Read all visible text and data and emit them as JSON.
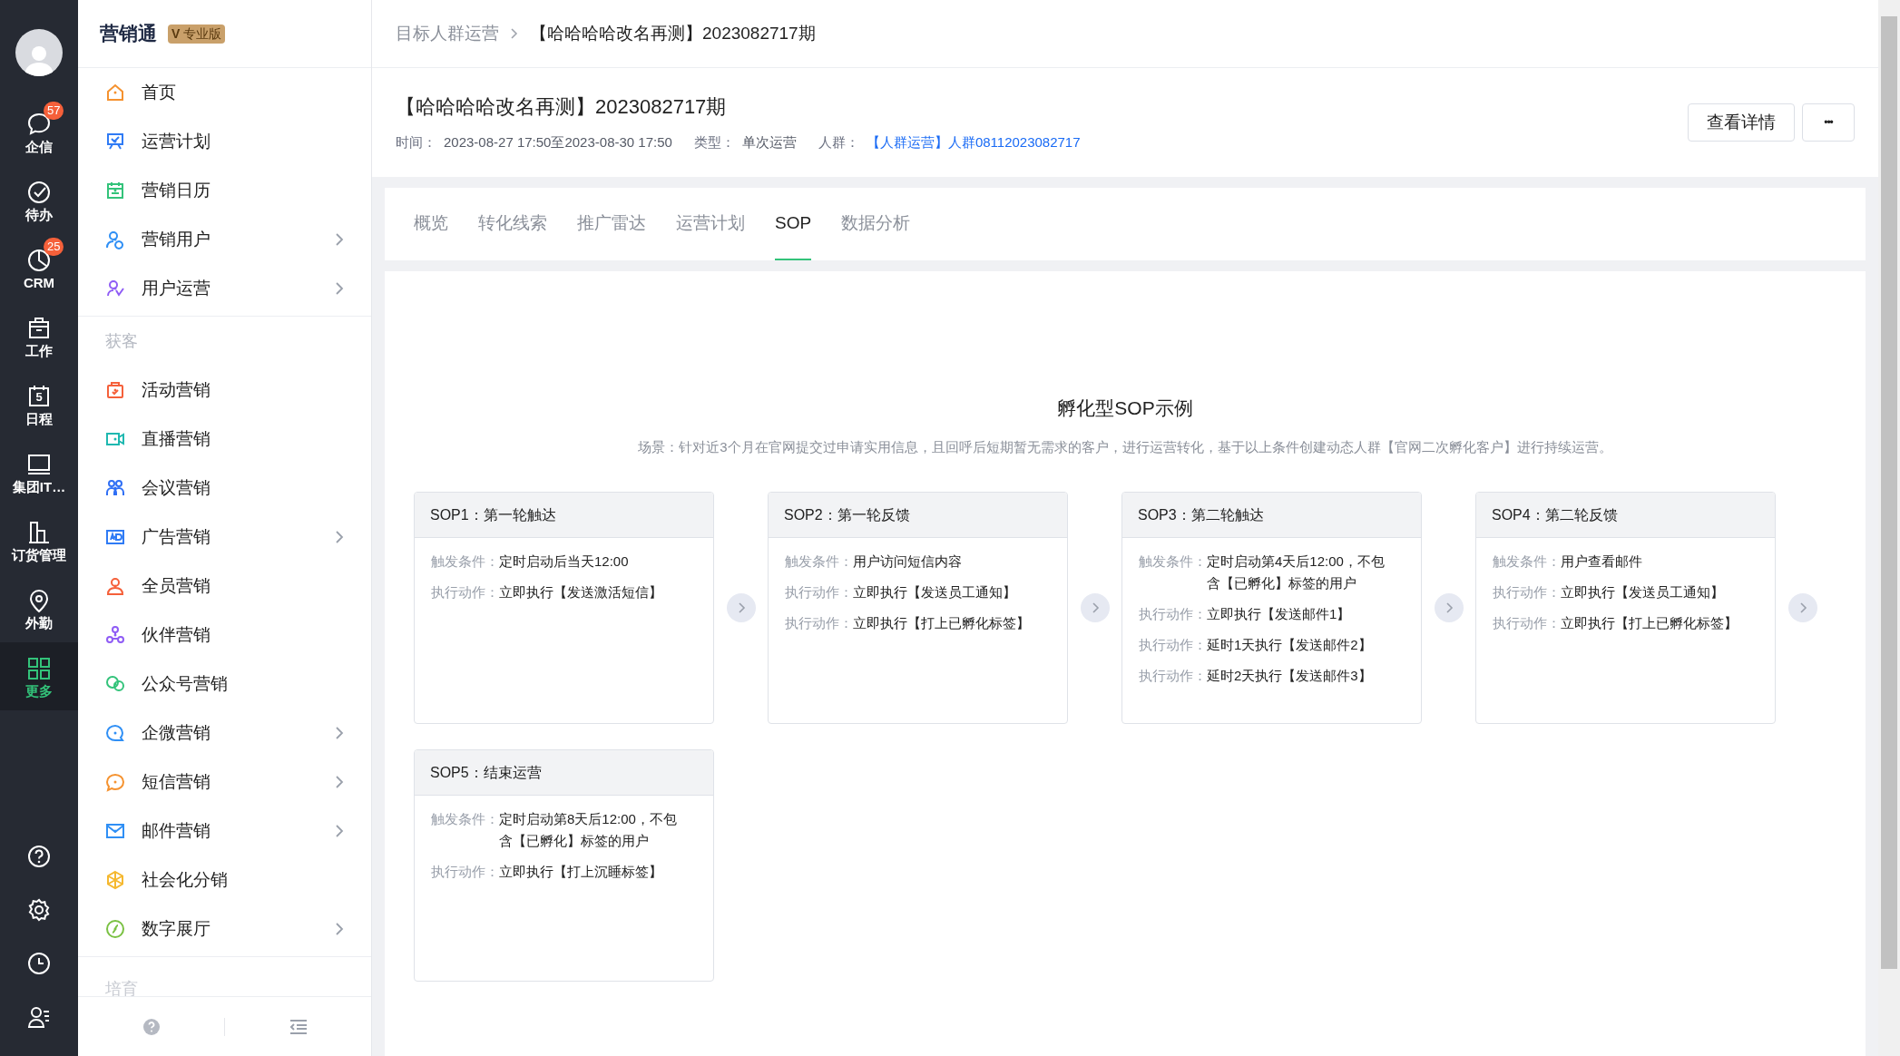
{
  "rail": {
    "items": [
      {
        "label": "企信",
        "badge": "57",
        "selected": false
      },
      {
        "label": "待办",
        "selected": false
      },
      {
        "label": "CRM",
        "badge": "25",
        "selected": false
      },
      {
        "label": "工作",
        "selected": false
      },
      {
        "label": "日程",
        "icon_text": "5",
        "selected": false
      },
      {
        "label": "集团IT…",
        "selected": false
      },
      {
        "label": "订货管理",
        "selected": false
      },
      {
        "label": "外勤",
        "selected": false
      },
      {
        "label": "更多",
        "selected": true
      }
    ]
  },
  "sidebar": {
    "app_name": "营销通",
    "edition": "专业版",
    "edition_mark": "V",
    "items": [
      {
        "label": "首页",
        "color": "#f5922f",
        "expandable": false
      },
      {
        "label": "运营计划",
        "color": "#2f7bf5",
        "expandable": false
      },
      {
        "label": "营销日历",
        "color": "#33c37a",
        "expandable": false
      },
      {
        "label": "营销用户",
        "color": "#2f8ff5",
        "expandable": true
      },
      {
        "label": "用户运营",
        "color": "#8f5cf5",
        "expandable": true
      }
    ],
    "section": "获客",
    "section_items": [
      {
        "label": "活动营销",
        "color": "#f5603a",
        "expandable": false
      },
      {
        "label": "直播营销",
        "color": "#1fb8b0",
        "expandable": false
      },
      {
        "label": "会议营销",
        "color": "#2f6ff5",
        "expandable": false
      },
      {
        "label": "广告营销",
        "color": "#2f7bf5",
        "expandable": true
      },
      {
        "label": "全员营销",
        "color": "#f5603a",
        "expandable": false
      },
      {
        "label": "伙伴营销",
        "color": "#8f5cf5",
        "expandable": false
      },
      {
        "label": "公众号营销",
        "color": "#33c37a",
        "expandable": false
      },
      {
        "label": "企微营销",
        "color": "#2f8ff5",
        "expandable": true
      },
      {
        "label": "短信营销",
        "color": "#f5922f",
        "expandable": true
      },
      {
        "label": "邮件营销",
        "color": "#2f8ff5",
        "expandable": true
      },
      {
        "label": "社会化分销",
        "color": "#f5b82f",
        "expandable": false
      },
      {
        "label": "数字展厅",
        "color": "#7ac143",
        "expandable": true
      }
    ],
    "section2": "培育"
  },
  "breadcrumb": [
    "目标人群运营",
    "【哈哈哈哈改名再测】2023082717期"
  ],
  "header": {
    "title": "【哈哈哈哈改名再测】2023082717期",
    "meta": [
      {
        "label": "时间：",
        "value": "2023-08-27 17:50至2023-08-30 17:50",
        "kind": "text"
      },
      {
        "label": "类型：",
        "value": "单次运营",
        "kind": "text"
      },
      {
        "label": "人群：",
        "value": "【人群运营】人群08112023082717",
        "kind": "link"
      }
    ],
    "buttons": [
      "查看详情",
      "•••"
    ]
  },
  "tabs": [
    {
      "label": "概览",
      "selected": false
    },
    {
      "label": "转化线索",
      "selected": false
    },
    {
      "label": "推广雷达",
      "selected": false
    },
    {
      "label": "运营计划",
      "selected": false
    },
    {
      "label": "SOP",
      "selected": true
    },
    {
      "label": "数据分析",
      "selected": false
    }
  ],
  "sop": {
    "title": "孵化型SOP示例",
    "scenario": "场景：针对近3个月在官网提交过申请实用信息，且回呼后短期暂无需求的客户，进行运营转化，基于以上条件创建动态人群【官网二次孵化客户】进行持续运营。",
    "cards": [
      {
        "title": "SOP1：第一轮触达",
        "rows": [
          {
            "label": "触发条件：",
            "value": "定时启动后当天12:00"
          },
          {
            "label": "执行动作：",
            "value": "立即执行【发送激活短信】"
          }
        ]
      },
      {
        "title": "SOP2：第一轮反馈",
        "rows": [
          {
            "label": "触发条件：",
            "value": "用户访问短信内容"
          },
          {
            "label": "执行动作：",
            "value": "立即执行【发送员工通知】"
          },
          {
            "label": "执行动作：",
            "value": "立即执行【打上已孵化标签】"
          }
        ]
      },
      {
        "title": "SOP3：第二轮触达",
        "rows": [
          {
            "label": "触发条件：",
            "value": "定时启动第4天后12:00，不包含【已孵化】标签的用户"
          },
          {
            "label": "执行动作：",
            "value": "立即执行【发送邮件1】"
          },
          {
            "label": "执行动作：",
            "value": "延时1天执行【发送邮件2】"
          },
          {
            "label": "执行动作：",
            "value": "延时2天执行【发送邮件3】"
          }
        ]
      },
      {
        "title": "SOP4：第二轮反馈",
        "rows": [
          {
            "label": "触发条件：",
            "value": "用户查看邮件"
          },
          {
            "label": "执行动作：",
            "value": "立即执行【发送员工通知】"
          },
          {
            "label": "执行动作：",
            "value": "立即执行【打上已孵化标签】"
          }
        ]
      },
      {
        "title": "SOP5：结束运营",
        "rows": [
          {
            "label": "触发条件：",
            "value": "定时启动第8天后12:00，不包含【已孵化】标签的用户"
          },
          {
            "label": "执行动作：",
            "value": "立即执行【打上沉睡标签】"
          }
        ]
      }
    ]
  }
}
